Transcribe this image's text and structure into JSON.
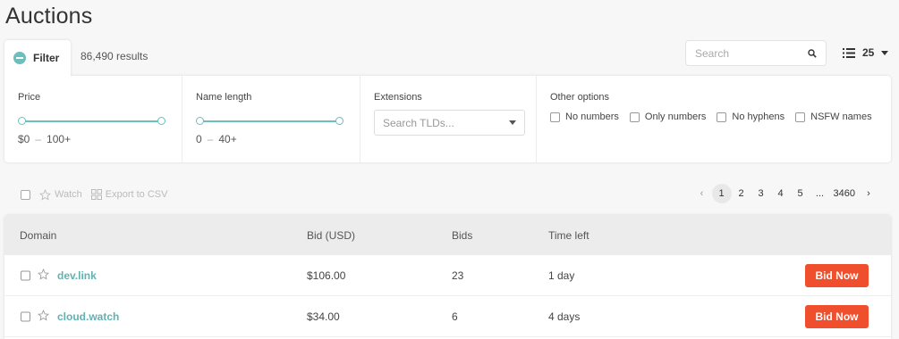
{
  "page": {
    "title": "Auctions"
  },
  "filter": {
    "tab_label": "Filter",
    "results": "86,490 results"
  },
  "search": {
    "placeholder": "Search"
  },
  "per_page": {
    "value": "25"
  },
  "filters": {
    "price": {
      "label": "Price",
      "min": "$0",
      "max": "100+"
    },
    "name_length": {
      "label": "Name length",
      "min": "0",
      "max": "40+"
    },
    "extensions": {
      "label": "Extensions",
      "placeholder": "Search TLDs..."
    },
    "other": {
      "label": "Other options",
      "options": [
        "No numbers",
        "Only numbers",
        "No hyphens",
        "NSFW names"
      ]
    }
  },
  "toolbar": {
    "watch": "Watch",
    "export": "Export to CSV"
  },
  "pagination": {
    "pages": [
      "1",
      "2",
      "3",
      "4",
      "5",
      "...",
      "3460"
    ],
    "current": "1"
  },
  "table": {
    "headers": {
      "domain": "Domain",
      "bid": "Bid (USD)",
      "bids": "Bids",
      "time": "Time left"
    },
    "rows": [
      {
        "domain": "dev.link",
        "bid": "$106.00",
        "bids": "23",
        "time": "1 day",
        "action": "Bid Now"
      },
      {
        "domain": "cloud.watch",
        "bid": "$34.00",
        "bids": "6",
        "time": "4 days",
        "action": "Bid Now"
      }
    ]
  },
  "colors": {
    "accent": "#6cbfbd",
    "bid_button": "#ef4f2c"
  }
}
